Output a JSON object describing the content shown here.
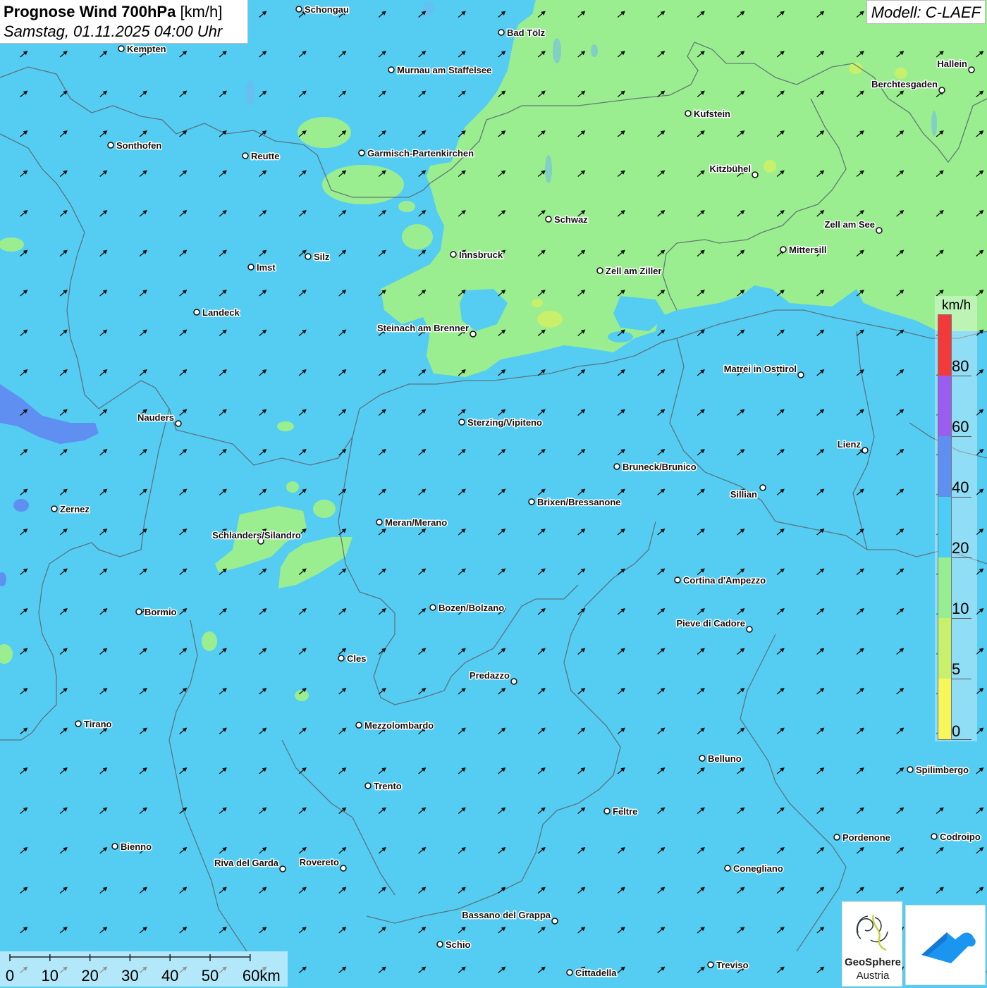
{
  "header": {
    "title": "Prognose Wind 700hPa",
    "unit": "[km/h]",
    "datetime": "Samstag, 01.11.2025 04:00 Uhr"
  },
  "model": "Modell: C-LAEF",
  "map": {
    "type": "wind forecast map",
    "wind_direction": "south-westerly flow, arrows pointing north-east",
    "background_colors": {
      "light_green_10_20": "#96ee90",
      "light_blue_20_40": "#55cdf2",
      "blue_40_60": "#5f8ff0"
    },
    "cities": [
      {
        "name": "Schongau"
      },
      {
        "name": "Bad Tölz"
      },
      {
        "name": "Kempten"
      },
      {
        "name": "Murnau am Staffelsee"
      },
      {
        "name": "Hallein"
      },
      {
        "name": "Berchtesgaden"
      },
      {
        "name": "Kufstein"
      },
      {
        "name": "Sonthofen"
      },
      {
        "name": "Reutte"
      },
      {
        "name": "Garmisch-Partenkirchen"
      },
      {
        "name": "Kitzbühel"
      },
      {
        "name": "Schwaz"
      },
      {
        "name": "Zell am See"
      },
      {
        "name": "Mittersill"
      },
      {
        "name": "Innsbruck"
      },
      {
        "name": "Silz"
      },
      {
        "name": "Imst"
      },
      {
        "name": "Zell am Ziller"
      },
      {
        "name": "Landeck"
      },
      {
        "name": "Steinach am Brenner"
      },
      {
        "name": "Matrei in Osttirol"
      },
      {
        "name": "Nauders"
      },
      {
        "name": "Sterzing/Vipiteno"
      },
      {
        "name": "Lienz"
      },
      {
        "name": "Bruneck/Brunico"
      },
      {
        "name": "Sillian"
      },
      {
        "name": "Zernez"
      },
      {
        "name": "Brixen/Bressanone"
      },
      {
        "name": "Meran/Merano"
      },
      {
        "name": "Schlanders/Silandro"
      },
      {
        "name": "Cortina d'Ampezzo"
      },
      {
        "name": "Bormio"
      },
      {
        "name": "Bozen/Bolzano"
      },
      {
        "name": "Pieve di Cadore"
      },
      {
        "name": "Cles"
      },
      {
        "name": "Predazzo"
      },
      {
        "name": "Tirano"
      },
      {
        "name": "Mezzolombardo"
      },
      {
        "name": "Belluno"
      },
      {
        "name": "Spilimbergo"
      },
      {
        "name": "Trento"
      },
      {
        "name": "Feltre"
      },
      {
        "name": "Bienno"
      },
      {
        "name": "Pordenone"
      },
      {
        "name": "Codroipo"
      },
      {
        "name": "Riva del Garda"
      },
      {
        "name": "Rovereto"
      },
      {
        "name": "Conegliano"
      },
      {
        "name": "Bassano del Grappa"
      },
      {
        "name": "Schio"
      },
      {
        "name": "Treviso"
      },
      {
        "name": "Cittadella"
      }
    ]
  },
  "legend": {
    "unit": "km/h",
    "classes": [
      {
        "from": 0,
        "to": 5,
        "color": "#f7f75a"
      },
      {
        "from": 5,
        "to": 10,
        "color": "#c8f06a"
      },
      {
        "from": 10,
        "to": 20,
        "color": "#96ee90"
      },
      {
        "from": 20,
        "to": 40,
        "color": "#4ccdf5"
      },
      {
        "from": 40,
        "to": 60,
        "color": "#5f8ff0"
      },
      {
        "from": 60,
        "to": 80,
        "color": "#9b5cf0"
      },
      {
        "from": 80,
        "to": 100,
        "color": "#f23a3a"
      }
    ],
    "labels": [
      "0",
      "5",
      "10",
      "20",
      "40",
      "60",
      "80"
    ]
  },
  "scale_bar": {
    "labels": [
      "0",
      "10",
      "20",
      "30",
      "40",
      "50",
      "60km"
    ]
  },
  "logos": {
    "geosphere_name": "GeoSphere",
    "geosphere_country": "Austria",
    "app_icon": "cloud-arrow-app-icon"
  }
}
